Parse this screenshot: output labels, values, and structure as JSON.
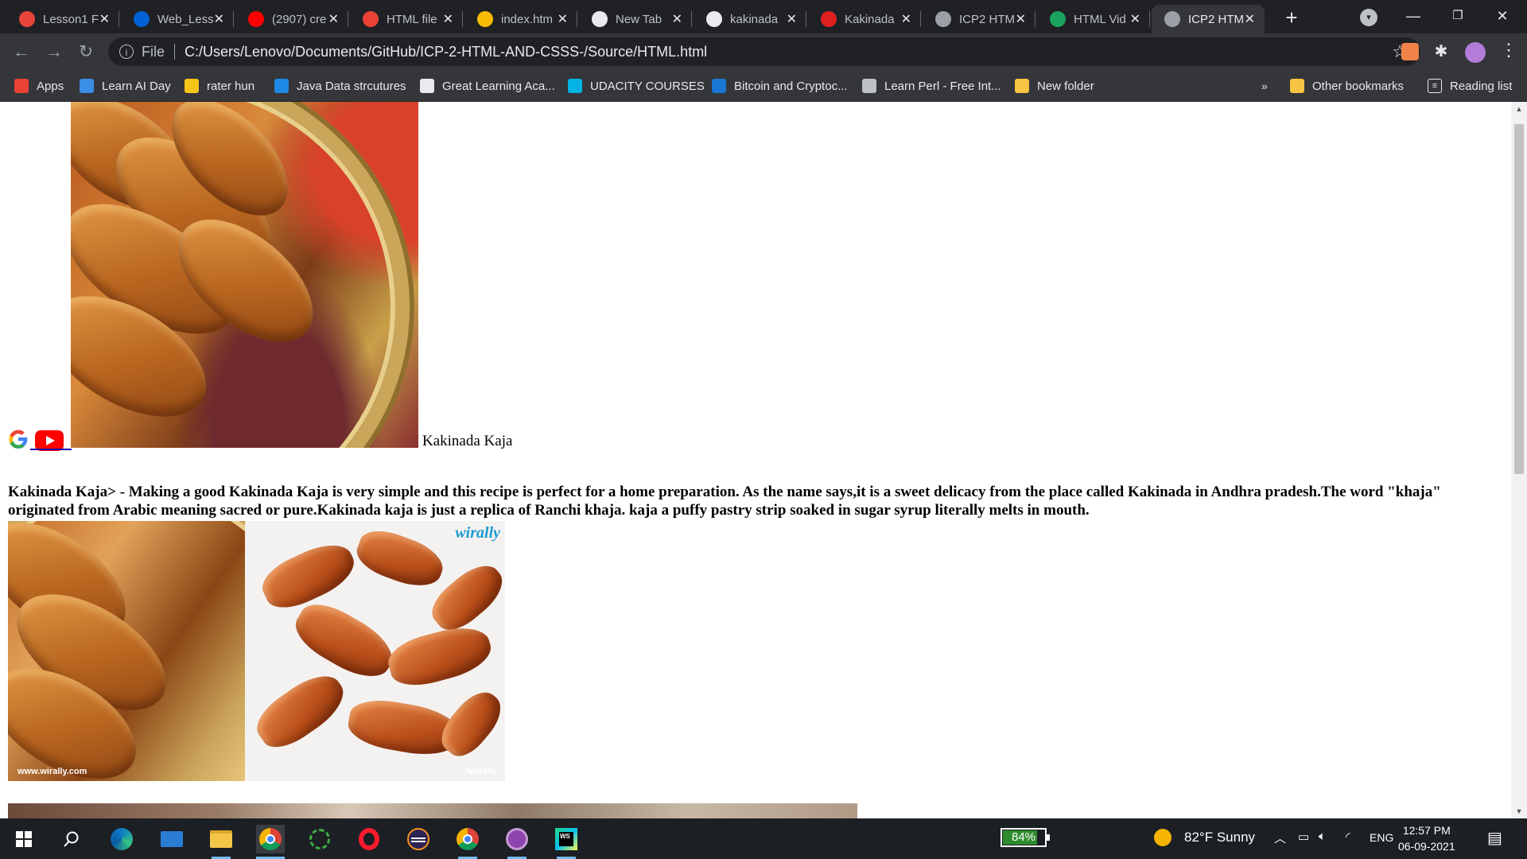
{
  "browser": {
    "tabs": [
      {
        "title": "Lesson1 F",
        "icon": "lesson-icon",
        "color": "#e8453c"
      },
      {
        "title": "Web_Less",
        "icon": "box-icon",
        "color": "#0061d5"
      },
      {
        "title": "(2907) cre",
        "icon": "youtube-icon",
        "color": "#ff0000"
      },
      {
        "title": "HTML file",
        "icon": "gmail-icon",
        "color": "#ea4335"
      },
      {
        "title": "index.htm",
        "icon": "drive-icon",
        "color": "#fbbc04"
      },
      {
        "title": "New Tab",
        "icon": "chrome-icon",
        "color": "#e8eaed"
      },
      {
        "title": "kakinada",
        "icon": "google-icon",
        "color": "#e8eaed"
      },
      {
        "title": "Kakinada",
        "icon": "red-circle-icon",
        "color": "#e02020"
      },
      {
        "title": "ICP2 HTM",
        "icon": "globe-icon",
        "color": "#9aa0a6"
      },
      {
        "title": "HTML Vid",
        "icon": "w-icon",
        "color": "#1aa260"
      },
      {
        "title": "ICP2 HTM",
        "icon": "globe-icon",
        "color": "#9aa0a6",
        "active": true
      }
    ],
    "new_tab_symbol": "+",
    "window_controls": {
      "minimize": "—",
      "restore": "❐",
      "close": "✕"
    },
    "address": {
      "scheme": "File",
      "url": "C:/Users/Lenovo/Documents/GitHub/ICP-2-HTML-AND-CSSS-/Source/HTML.html"
    },
    "bookmarks": [
      {
        "label": "Apps",
        "icon": "apps-grid-icon",
        "color": "#ea4335"
      },
      {
        "label": "Learn AI Day",
        "icon": "cube-icon",
        "color": "#3a8ee6"
      },
      {
        "label": "rater hun",
        "icon": "rater-icon",
        "color": "#f5c518"
      },
      {
        "label": "Java Data strcutures",
        "icon": "s-icon",
        "color": "#1e88e5"
      },
      {
        "label": "Great Learning Aca...",
        "icon": "google-icon",
        "color": "#e8eaed"
      },
      {
        "label": "UDACITY COURSES",
        "icon": "udacity-icon",
        "color": "#02b3e4"
      },
      {
        "label": "Bitcoin and Cryptoc...",
        "icon": "c-icon",
        "color": "#1976d2"
      },
      {
        "label": "Learn Perl - Free Int...",
        "icon": "perl-icon",
        "color": "#bdc1c6"
      },
      {
        "label": "New folder",
        "icon": "folder-icon",
        "color": "#f6c342"
      }
    ],
    "bookmarks_overflow": "»",
    "other_bookmarks": "Other bookmarks",
    "reading_list": "Reading list"
  },
  "page": {
    "caption": "Kakinada Kaja",
    "description": "Kakinada Kaja> - Making a good Kakinada Kaja is very simple and this recipe is perfect for a home preparation. As the name says,it is a sweet delicacy from the place called Kakinada in Andhra pradesh.The word \"khaja\" originated from Arabic meaning sacred or pure.Kakinada kaja is just a replica of Ranchi khaja. kaja a puffy pastry strip soaked in sugar syrup literally melts in mouth.",
    "image_brand_top": "wirally",
    "image_brand_bottom_left": "www.wirally.com",
    "image_brand_bottom_right": "/Wirally"
  },
  "taskbar": {
    "battery_level": 0.84,
    "battery_text": "84%",
    "weather": "82°F  Sunny",
    "language": "ENG",
    "time": "12:57 PM",
    "date": "06-09-2021"
  }
}
